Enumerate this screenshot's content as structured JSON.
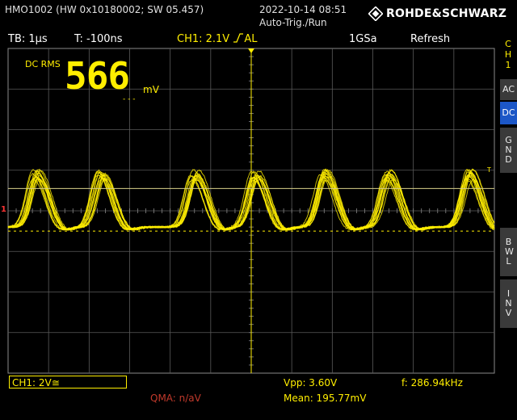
{
  "header": {
    "device": "HMO1002 (HW 0x10180002; SW 05.457)",
    "datetime": "2022-10-14 08:51",
    "trigger_mode": "Auto-Trig./Run",
    "brand": "ROHDE&SCHWARZ"
  },
  "infobar": {
    "timebase": "TB: 1µs",
    "trigger_time": "T: -100ns",
    "channel_trigger": "CH1: 2.1V",
    "trigger_slope_mode": "AL",
    "sample_rate": "1GSa",
    "acq_mode": "Refresh"
  },
  "channel_tab": {
    "lines": [
      "C",
      "H",
      "1"
    ]
  },
  "side_buttons": [
    {
      "label": "AC",
      "active": false
    },
    {
      "label": "DC",
      "active": true
    },
    {
      "label": "G N D",
      "active": false
    },
    {
      "label": "B W L",
      "active": false
    },
    {
      "label": "I N V",
      "active": false
    }
  ],
  "measurement": {
    "label": "DC RMS",
    "value": "566",
    "unit": "mV",
    "dashes": "- - -"
  },
  "markers": {
    "ground_marker": "1",
    "trigger_level_marker": "T"
  },
  "bottom": {
    "channel_setting": "CH1: 2V≅",
    "qma": "QMA: n/aV",
    "vpp": "Vpp: 3.60V",
    "mean": "Mean: 195.77mV",
    "frequency": "f: 286.94kHz"
  },
  "colors": {
    "trace": "#ffee00",
    "grid": "#5a5a5a",
    "active_button": "#1c57c7",
    "qma": "#c0392b"
  },
  "waveform": {
    "baseline_v": 0.2,
    "peak_v": 2.9,
    "peaks_us": [
      0.35,
      1.15,
      2.3,
      3.05,
      3.9,
      4.7,
      5.7
    ]
  }
}
